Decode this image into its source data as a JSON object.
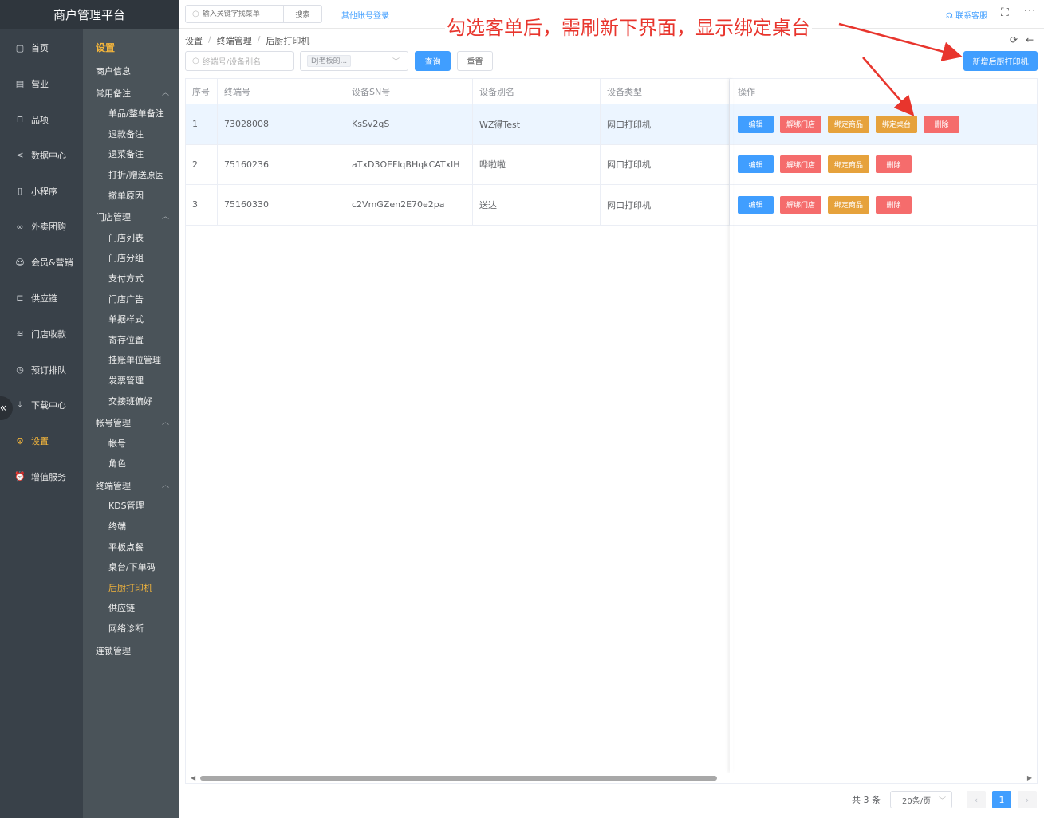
{
  "brand": "商户管理平台",
  "primary_nav": [
    {
      "label": "首页",
      "icon": "page-icon"
    },
    {
      "label": "营业",
      "icon": "calendar-icon"
    },
    {
      "label": "品项",
      "icon": "bag-icon"
    },
    {
      "label": "数据中心",
      "icon": "share-icon"
    },
    {
      "label": "小程序",
      "icon": "phone-icon"
    },
    {
      "label": "外卖团购",
      "icon": "bike-icon"
    },
    {
      "label": "会员&营销",
      "icon": "user-icon"
    },
    {
      "label": "供应链",
      "icon": "truck-icon"
    },
    {
      "label": "门店收款",
      "icon": "database-icon"
    },
    {
      "label": "预订排队",
      "icon": "clock-icon"
    },
    {
      "label": "下载中心",
      "icon": "download-icon"
    },
    {
      "label": "设置",
      "icon": "gear-icon"
    },
    {
      "label": "增值服务",
      "icon": "alarm-icon"
    }
  ],
  "collapse_glyph": "«",
  "secondary_nav": {
    "title": "设置",
    "merchant_info": "商户信息",
    "groups": [
      {
        "label": "常用备注",
        "items": [
          "单品/整单备注",
          "退款备注",
          "退菜备注",
          "打折/赠送原因",
          "撤单原因"
        ]
      },
      {
        "label": "门店管理",
        "items": [
          "门店列表",
          "门店分组",
          "支付方式",
          "门店广告",
          "单据样式",
          "寄存位置",
          "挂账单位管理",
          "发票管理",
          "交接班偏好"
        ]
      },
      {
        "label": "帐号管理",
        "items": [
          "帐号",
          "角色"
        ]
      },
      {
        "label": "终端管理",
        "items": [
          "KDS管理",
          "终端",
          "平板点餐",
          "桌台/下单码",
          "后厨打印机",
          "供应链",
          "网络诊断"
        ]
      }
    ],
    "chain": "连锁管理"
  },
  "header": {
    "search_placeholder": "输入关键字找菜单",
    "search_button": "搜索",
    "other_login": "其他账号登录",
    "contact": "联系客服",
    "fullscreen_glyph": "⛶",
    "more_glyph": "···"
  },
  "annotation": {
    "text": "勾选客单后，需刷新下界面，显示绑定桌台",
    "color": "#e8352d"
  },
  "breadcrumb": [
    "设置",
    "终端管理",
    "后厨打印机"
  ],
  "filters": {
    "keyword_placeholder": "终端号/设备别名",
    "store_tag": "DJ老板的...",
    "query": "查询",
    "reset": "重置",
    "add": "新增后厨打印机"
  },
  "table": {
    "columns": [
      "序号",
      "终端号",
      "设备SN号",
      "设备别名",
      "设备类型",
      "操作"
    ],
    "rows": [
      {
        "idx": "1",
        "terminal": "73028008",
        "sn": "KsSv2qS",
        "alias": "WZ得Test",
        "type": "网口打印机",
        "ops": [
          "编辑",
          "解绑门店",
          "绑定商品",
          "绑定桌台",
          "删除"
        ]
      },
      {
        "idx": "2",
        "terminal": "75160236",
        "sn": "aTxD3OEFlqBHqkCATxlH",
        "alias": "哗啦啦",
        "type": "网口打印机",
        "ops": [
          "编辑",
          "解绑门店",
          "绑定商品",
          "删除"
        ]
      },
      {
        "idx": "3",
        "terminal": "75160330",
        "sn": "c2VmGZen2E70e2pa",
        "alias": "送达",
        "type": "网口打印机",
        "ops": [
          "编辑",
          "解绑门店",
          "绑定商品",
          "删除"
        ]
      }
    ]
  },
  "pagination": {
    "total": "共 3 条",
    "page_size": "20条/页",
    "current": "1",
    "prev": "‹",
    "next": "›"
  },
  "colors": {
    "primary": "#409eff",
    "danger": "#f56c6c",
    "warning": "#e6a23c",
    "accent": "#f5b63b",
    "sidebar": "#394149",
    "sidebar2": "#4a5359"
  }
}
